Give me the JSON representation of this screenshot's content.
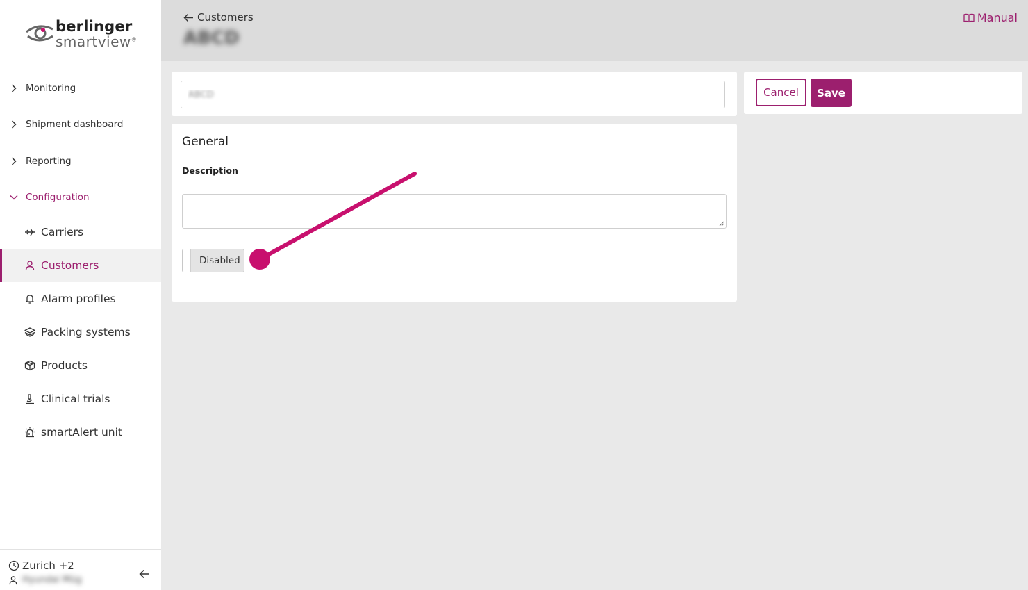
{
  "brand": {
    "line1": "berlinger",
    "line2": "smartview",
    "mark": "®"
  },
  "nav": {
    "sections": [
      {
        "label": "Monitoring"
      },
      {
        "label": "Shipment dashboard"
      },
      {
        "label": "Reporting"
      },
      {
        "label": "Configuration"
      }
    ],
    "items": [
      {
        "label": "Carriers",
        "icon": "plane-icon"
      },
      {
        "label": "Customers",
        "icon": "user-icon"
      },
      {
        "label": "Alarm profiles",
        "icon": "bell-icon"
      },
      {
        "label": "Packing systems",
        "icon": "layers-icon"
      },
      {
        "label": "Products",
        "icon": "box-icon"
      },
      {
        "label": "Clinical trials",
        "icon": "microscope-icon"
      },
      {
        "label": "smartAlert unit",
        "icon": "siren-icon"
      }
    ]
  },
  "footer": {
    "timezone": "Zurich +2",
    "user_name": "Hyundai Müg"
  },
  "header": {
    "back_label": "Customers",
    "title": "ABCD",
    "manual_label": "Manual"
  },
  "form": {
    "name_value": "ABCD",
    "cancel_label": "Cancel",
    "save_label": "Save",
    "section_title": "General",
    "description_label": "Description",
    "description_value": "",
    "toggle_label": "Disabled"
  },
  "colors": {
    "accent": "#9c1f6e",
    "annotation": "#c8106e"
  }
}
